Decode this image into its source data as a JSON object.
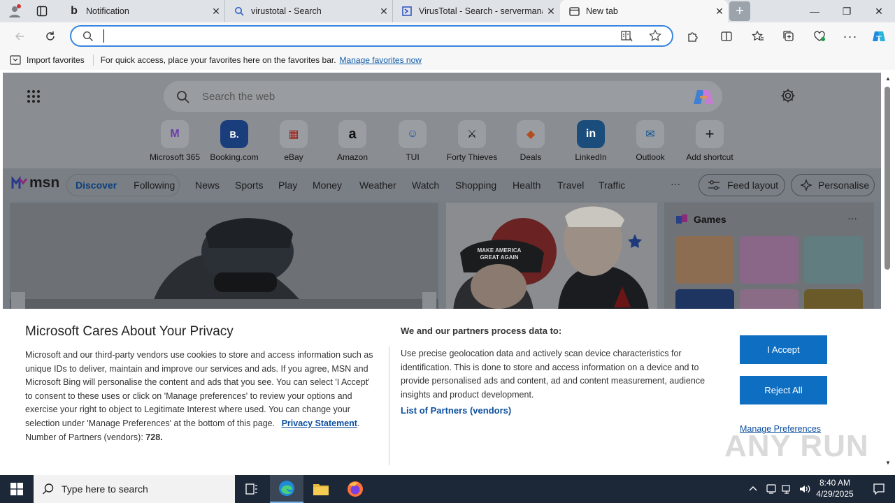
{
  "tabs": [
    {
      "title": "Notification",
      "icon": "bing-icon"
    },
    {
      "title": "virustotal - Search",
      "icon": "search-icon"
    },
    {
      "title": "VirusTotal - Search - servermanag",
      "icon": "virustotal-icon"
    },
    {
      "title": "New tab",
      "icon": "newtab-icon"
    }
  ],
  "address": {
    "value": ""
  },
  "favbar": {
    "import_label": "Import favorites",
    "message": "For quick access, place your favorites here on the favorites bar.",
    "manage_link": "Manage favorites now"
  },
  "newtab": {
    "search_placeholder": "Search the web",
    "shortcuts": [
      {
        "label": "Microsoft 365",
        "icon": "M"
      },
      {
        "label": "Booking.com",
        "icon": "B."
      },
      {
        "label": "eBay",
        "icon": "▦"
      },
      {
        "label": "Amazon",
        "icon": "a"
      },
      {
        "label": "TUI",
        "icon": "☺"
      },
      {
        "label": "Forty Thieves",
        "icon": "⚔"
      },
      {
        "label": "Deals",
        "icon": "◆"
      },
      {
        "label": "LinkedIn",
        "icon": "in"
      },
      {
        "label": "Outlook",
        "icon": "✉"
      },
      {
        "label": "Add shortcut",
        "icon": "+"
      }
    ]
  },
  "msn": {
    "logo": "msn",
    "discover": "Discover",
    "following": "Following",
    "nav": [
      "News",
      "Sports",
      "Play",
      "Money",
      "Weather",
      "Watch",
      "Shopping",
      "Health",
      "Travel",
      "Traffic"
    ],
    "more": "···",
    "feed_layout": "Feed layout",
    "personalise": "Personalise",
    "games_title": "Games",
    "hat_text": "MAKE AMERICA GREAT AGAIN"
  },
  "privacy": {
    "title": "Microsoft Cares About Your Privacy",
    "body": "Microsoft and our third-party vendors use cookies to store and access information such as unique IDs to deliver, maintain and improve our services and ads. If you agree, MSN and Microsoft Bing will personalise the content and ads that you see. You can select 'I Accept' to consent to these uses or click on 'Manage preferences' to review your options and exercise your right to object to Legitimate Interest where used.  You can change your selection under 'Manage Preferences' at the bottom of this page.",
    "privacy_link": "Privacy Statement",
    "partners_label": "Number of Partners (vendors):",
    "partners_count": "728.",
    "purposes_title": "We and our partners process data to:",
    "purposes_body": "Use precise geolocation data and actively scan device characteristics for identification. This is done to store and access information on a device and to provide personalised ads and content, ad and content measurement, audience insights and product development.",
    "partners_link": "List of Partners (vendors)",
    "accept": "I Accept",
    "reject": "Reject All",
    "manage": "Manage Preferences"
  },
  "watermark": "ANY RUN",
  "taskbar": {
    "search_placeholder": "Type here to search",
    "time": "8:40 AM",
    "date": "4/29/2025"
  }
}
